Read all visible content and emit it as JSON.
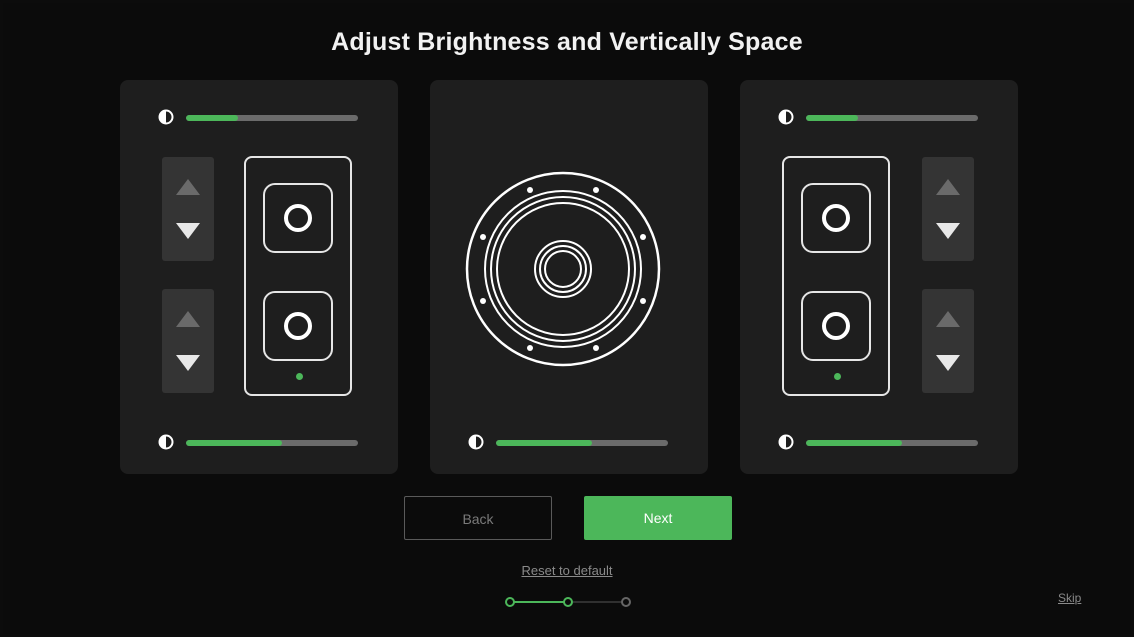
{
  "header": {
    "title": "Adjust Brightness and Vertically Space"
  },
  "panels": {
    "left": {
      "top_brightness": 0.3,
      "bottom_brightness": 0.56
    },
    "center": {
      "brightness": 0.56
    },
    "right": {
      "top_brightness": 0.3,
      "bottom_brightness": 0.56
    }
  },
  "icons": {
    "brightness": "contrast-half-circle-icon",
    "up": "triangle-up-icon",
    "down": "triangle-down-icon"
  },
  "footer": {
    "back_label": "Back",
    "next_label": "Next",
    "reset_label": "Reset to default",
    "skip_label": "Skip",
    "steps_total": 3,
    "current_step": 2
  },
  "colors": {
    "accent": "#4cb75a",
    "panel": "#1e1e1e",
    "background": "#0b0b0b",
    "track": "#6b6b6b"
  }
}
